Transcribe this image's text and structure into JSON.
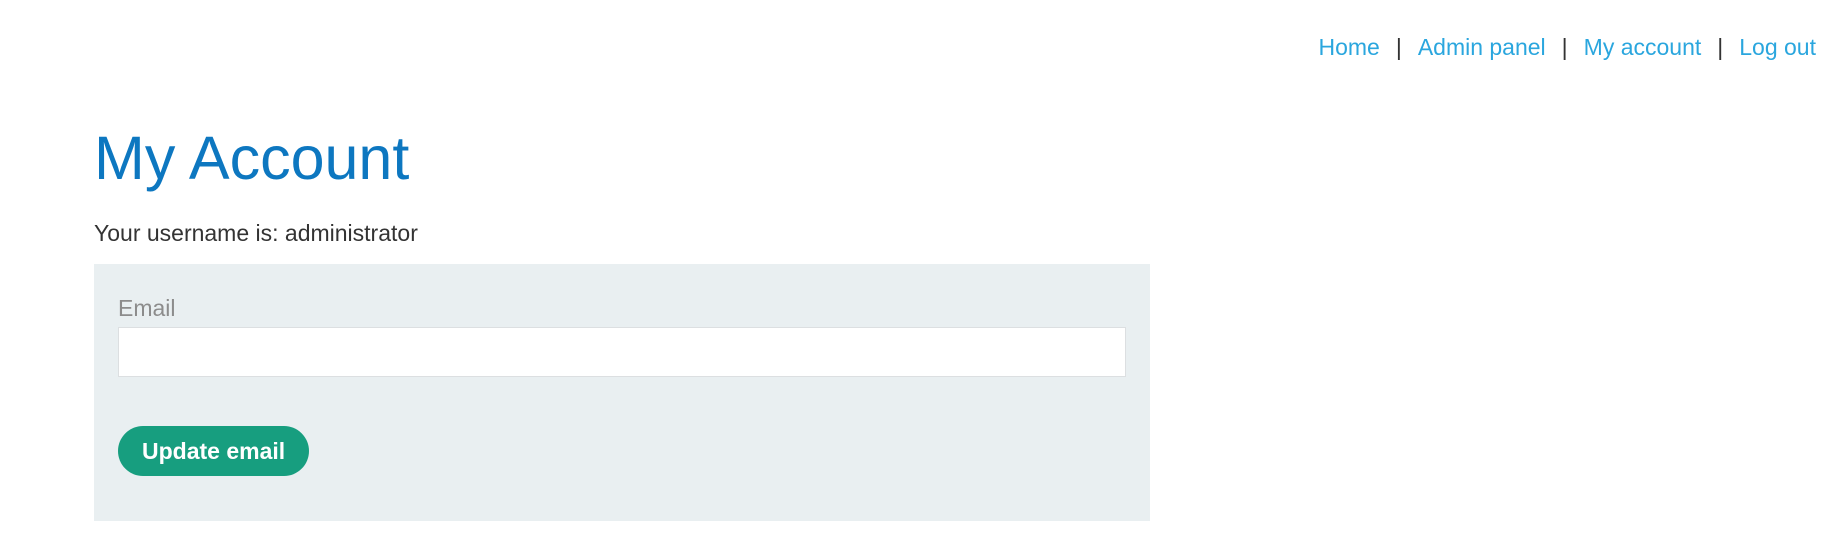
{
  "nav": {
    "items": [
      {
        "label": "Home"
      },
      {
        "label": "Admin panel"
      },
      {
        "label": "My account"
      },
      {
        "label": "Log out"
      }
    ],
    "separator": "|"
  },
  "page": {
    "title": "My Account",
    "username_line": "Your username is: administrator"
  },
  "form": {
    "email_label": "Email",
    "email_value": "",
    "submit_label": "Update email"
  },
  "colors": {
    "link": "#2aa6de",
    "title": "#0d77c0",
    "panel_bg": "#e9eff1",
    "button_bg": "#179e7f"
  }
}
